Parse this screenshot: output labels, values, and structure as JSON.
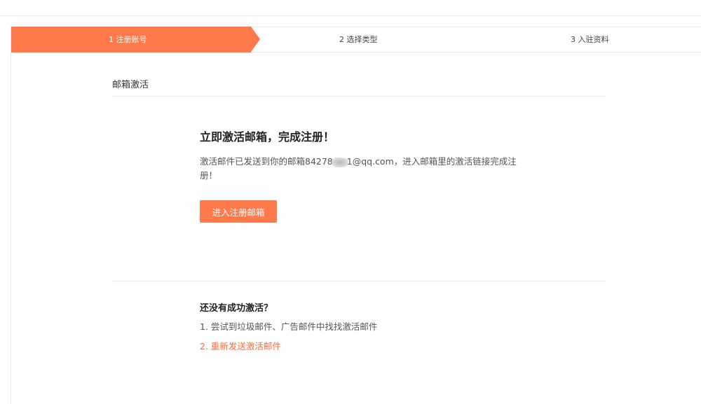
{
  "steps": [
    {
      "label": "1 注册账号",
      "state": "active"
    },
    {
      "label": "2 选择类型",
      "state": "pending"
    },
    {
      "label": "3 入驻资料",
      "state": "pending"
    }
  ],
  "colors": {
    "accent": "#ff7a4b",
    "link": "#ff6b3d"
  },
  "section": {
    "title": "邮箱激活"
  },
  "activation": {
    "headline": "立即激活邮箱，完成注册！",
    "message_before": "激活邮件已发送到你的邮箱84278",
    "message_after": "1@qq.com，进入邮箱里的激活链接完成注册！",
    "button_label": "进入注册邮箱"
  },
  "help": {
    "title": "还没有成功激活？",
    "items": [
      {
        "number": "1.",
        "text": "尝试到垃圾邮件、广告邮件中找找激活邮件"
      },
      {
        "number": "2.",
        "text": "重新发送激活邮件"
      }
    ]
  }
}
